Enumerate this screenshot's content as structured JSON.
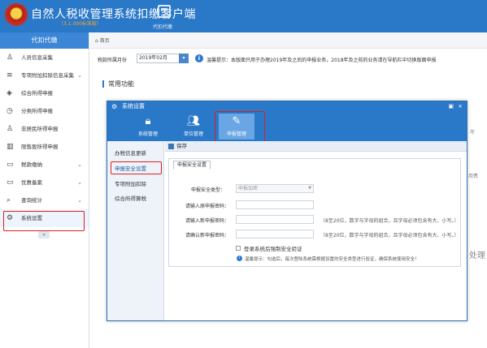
{
  "header": {
    "app_title": "自然人税收管理系统扣缴客户端",
    "version": "（3.1.090标准版）",
    "toolbar_label": "代扣代缴"
  },
  "sidebar": {
    "heading": "代扣代缴",
    "items": [
      {
        "label": "人员信息采集",
        "icon": "person-icon",
        "chevron": false
      },
      {
        "label": "专项附加扣除信息采集",
        "icon": "list-icon",
        "chevron": true
      },
      {
        "label": "综合所得申报",
        "icon": "layers-icon",
        "chevron": false
      },
      {
        "label": "分类所得申报",
        "icon": "clock-icon",
        "chevron": false
      },
      {
        "label": "非居民所得申报",
        "icon": "person-icon",
        "chevron": false
      },
      {
        "label": "限售股所得申报",
        "icon": "bar-chart-icon",
        "chevron": false
      },
      {
        "label": "税款缴纳",
        "icon": "folder-icon",
        "chevron": true
      },
      {
        "label": "优惠备案",
        "icon": "folder-icon",
        "chevron": true
      },
      {
        "label": "查询统计",
        "icon": "search-doc-icon",
        "chevron": true
      },
      {
        "label": "系统设置",
        "icon": "gear-icon",
        "chevron": false
      }
    ],
    "collapse_label": "«"
  },
  "tabbar": {
    "home": "首页"
  },
  "period": {
    "label": "税款所属月份",
    "value": "2019年02月",
    "tip": "温馨提示：本版面只用于办理2019年及之后的申报业务，2018年及之前的业务请在导航栏中切换版面申报"
  },
  "main": {
    "section_title": "常用功能",
    "bg_notes": [
      "年",
      "用费",
      "处理"
    ]
  },
  "dialog": {
    "title": "系统设置",
    "max_label": "▣",
    "close_label": "×",
    "toolbar": [
      {
        "label": "系统管理",
        "icon": "lock-icon"
      },
      {
        "label": "单位管理",
        "icon": "people-icon"
      },
      {
        "label": "申报管理",
        "icon": "edit-icon",
        "selected": true
      }
    ],
    "nav": [
      {
        "label": "办税信息更新"
      },
      {
        "label": "申报安全设置",
        "active": true
      },
      {
        "label": "专项附加扣除"
      },
      {
        "label": "综合所得算税"
      }
    ],
    "save_label": "保存",
    "panel_tab": "申报安全设置",
    "fields": [
      {
        "label": "申报安全类型：",
        "value": "申报加密",
        "hint": ""
      },
      {
        "label": "请输入原申报密码：",
        "value": "",
        "hint": ""
      },
      {
        "label": "请输入新申报密码：",
        "value": "",
        "hint": "（8至20位，数字与字母的组合，且字母必须包含有大、小写。）"
      },
      {
        "label": "请确认新申报密码：",
        "value": "",
        "hint": "（8至20位，数字与字母的组合，且字母必须包含有大、小写。）"
      }
    ],
    "checkbox_label": "登录系统后强制安全验证",
    "warn_text": "温馨提示：勾选后，每次登陆系统需根据设置的安全类型进行验证，确保系统使用安全！"
  }
}
